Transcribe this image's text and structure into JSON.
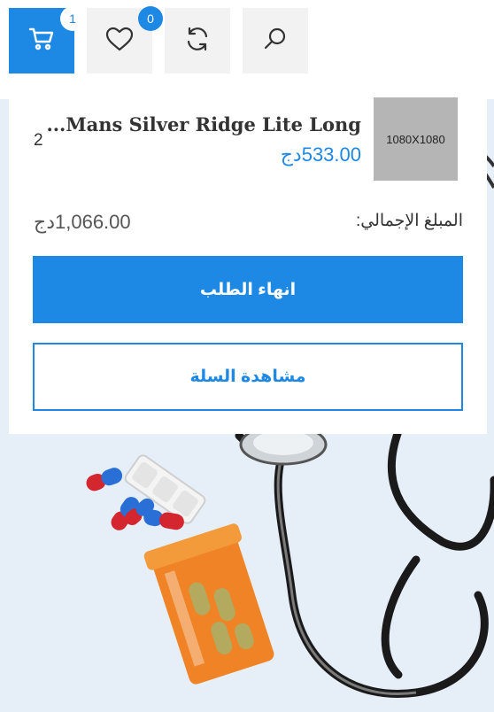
{
  "header": {
    "cart": {
      "icon": "cart-icon",
      "count": "1"
    },
    "wishlist": {
      "icon": "heart-icon",
      "count": "0"
    },
    "compare": {
      "icon": "refresh-icon"
    },
    "search": {
      "icon": "search-icon"
    }
  },
  "minicart": {
    "item": {
      "thumb_text": "1080X1080",
      "name": "...Mans Silver Ridge Lite Long",
      "price": "533.00دج",
      "quantity": "2"
    },
    "total_label": "المبلغ الإجمالي:",
    "total_value": "1,066.00دج",
    "checkout_label": "انهاء الطلب",
    "view_cart_label": "مشاهدة السلة"
  },
  "colors": {
    "accent": "#1e88e5",
    "hero_bg": "#e6eef8"
  }
}
